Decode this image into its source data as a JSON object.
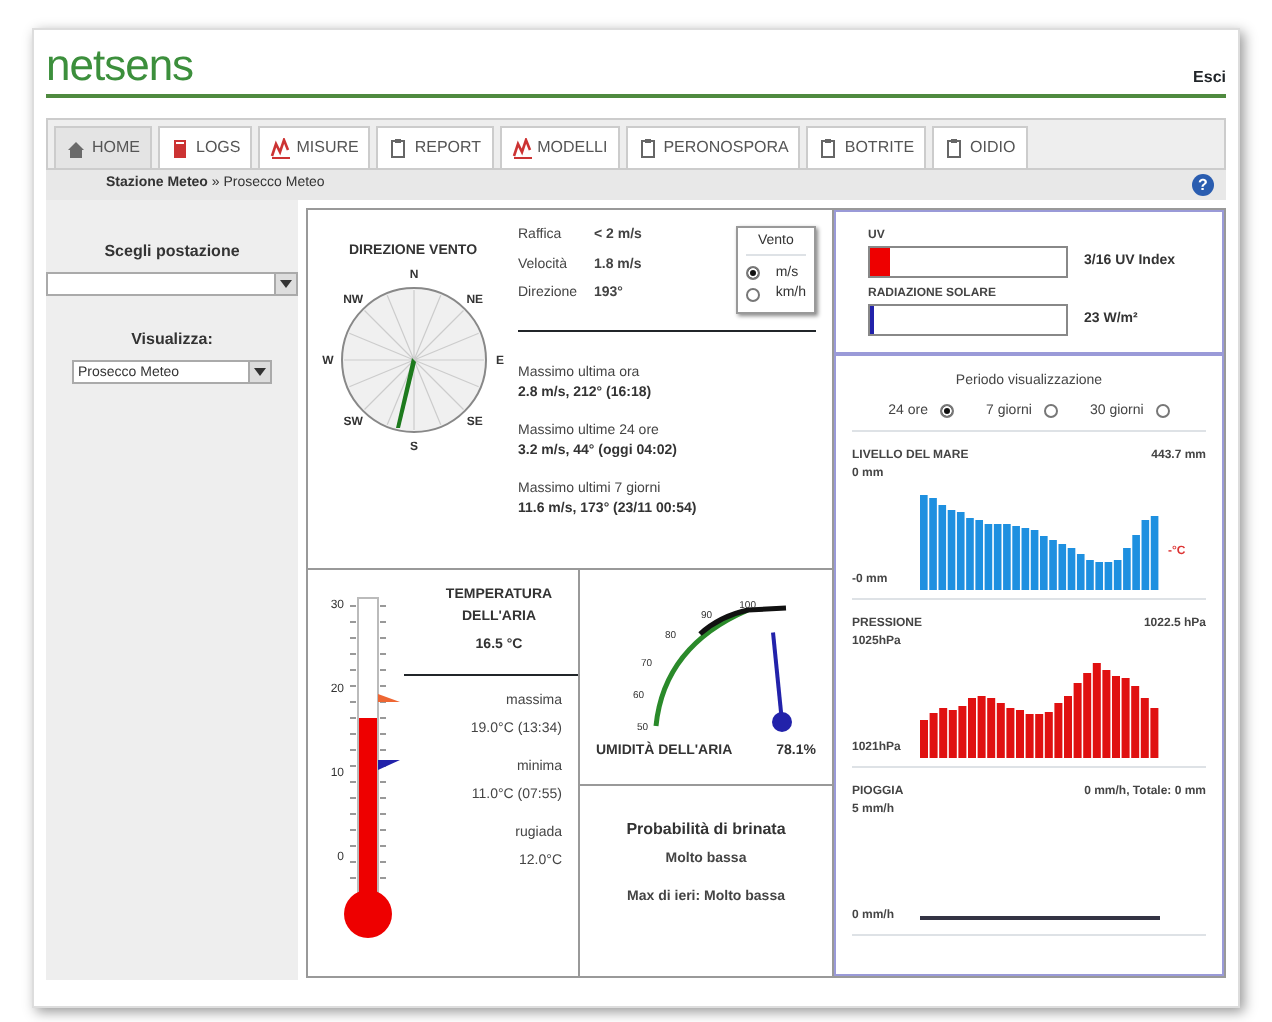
{
  "header": {
    "logo": "netsens",
    "logout": "Esci"
  },
  "tabs": [
    {
      "label": "HOME",
      "kind": "home",
      "selected": true
    },
    {
      "label": "LOGS",
      "kind": "book",
      "selected": false
    },
    {
      "label": "MISURE",
      "kind": "chart",
      "selected": false
    },
    {
      "label": "REPORT",
      "kind": "clipboard",
      "selected": false
    },
    {
      "label": "MODELLI",
      "kind": "chart",
      "selected": false
    },
    {
      "label": "PERONOSPORA",
      "kind": "clipboard",
      "selected": false
    },
    {
      "label": "BOTRITE",
      "kind": "clipboard",
      "selected": false
    },
    {
      "label": "OIDIO",
      "kind": "clipboard",
      "selected": false
    }
  ],
  "breadcrumb": {
    "parent": "Stazione Meteo",
    "current": "» Prosecco Meteo",
    "help": "?"
  },
  "sidebar": {
    "station_label": "Scegli postazione",
    "view_label": "Visualizza:",
    "view_value": "Prosecco Meteo"
  },
  "wind": {
    "title": "DIREZIONE VENTO",
    "compass": [
      "N",
      "NE",
      "E",
      "SE",
      "S",
      "SW",
      "W",
      "NW"
    ],
    "readings": [
      {
        "label": "Raffica",
        "value": "< 2 m/s"
      },
      {
        "label": "Velocità",
        "value": "1.8 m/s"
      },
      {
        "label": "Direzione",
        "value": "193°"
      }
    ],
    "unit_box": {
      "title": "Vento",
      "options": [
        {
          "label": "m/s",
          "selected": true
        },
        {
          "label": "km/h",
          "selected": false
        }
      ]
    },
    "maxima": [
      {
        "label": "Massimo ultima ora",
        "value": "2.8 m/s, 212° (16:18)"
      },
      {
        "label": "Massimo ultime 24 ore",
        "value": "3.2 m/s, 44° (oggi 04:02)"
      },
      {
        "label": "Massimo ultimi 7 giorni",
        "value": "11.6 m/s, 173° (23/11 00:54)"
      }
    ]
  },
  "uv": {
    "label": "UV",
    "level": 0.1,
    "reading": "3/16 UV Index"
  },
  "solar": {
    "label": "RADIAZIONE SOLARE",
    "level": 0.02,
    "reading": "23 W/m²"
  },
  "period": {
    "title": "Periodo visualizzazione",
    "options": [
      {
        "label": "24 ore",
        "selected": true
      },
      {
        "label": "7 giorni",
        "selected": false
      },
      {
        "label": "30 giorni",
        "selected": false
      }
    ]
  },
  "sea_level": {
    "label": "LIVELLO DEL MARE",
    "reading": "443.7 mm",
    "top_label": "0 mm",
    "bottom_label": "-0 mm",
    "side_label": "-°C"
  },
  "pressure": {
    "label": "PRESSIONE",
    "reading": "1022.5 hPa",
    "top_label": "1025hPa",
    "bottom_label": "1021hPa"
  },
  "rain": {
    "label": "PIOGGIA",
    "reading": "0 mm/h, Totale: 0 mm",
    "top_label": "5 mm/h",
    "bottom_label": "0 mm/h"
  },
  "temperature": {
    "title": "TEMPERATURA DELL'ARIA",
    "reading": "16.5 °C",
    "scale": [
      "30",
      "20",
      "10",
      "0"
    ],
    "stats": [
      {
        "label": "massima",
        "value": "19.0°C (13:34)"
      },
      {
        "label": "minima",
        "value": "11.0°C (07:55)"
      },
      {
        "label": "rugiada",
        "value": "12.0°C"
      }
    ]
  },
  "humidity": {
    "label": "UMIDITÀ DELL'ARIA",
    "reading": "78.1%",
    "scale": [
      "100",
      "90",
      "80",
      "70",
      "60",
      "50"
    ]
  },
  "frost": {
    "title": "Probabilità di brinata",
    "value": "Molto bassa",
    "yesterday": "Max di ieri: Molto bassa"
  }
}
